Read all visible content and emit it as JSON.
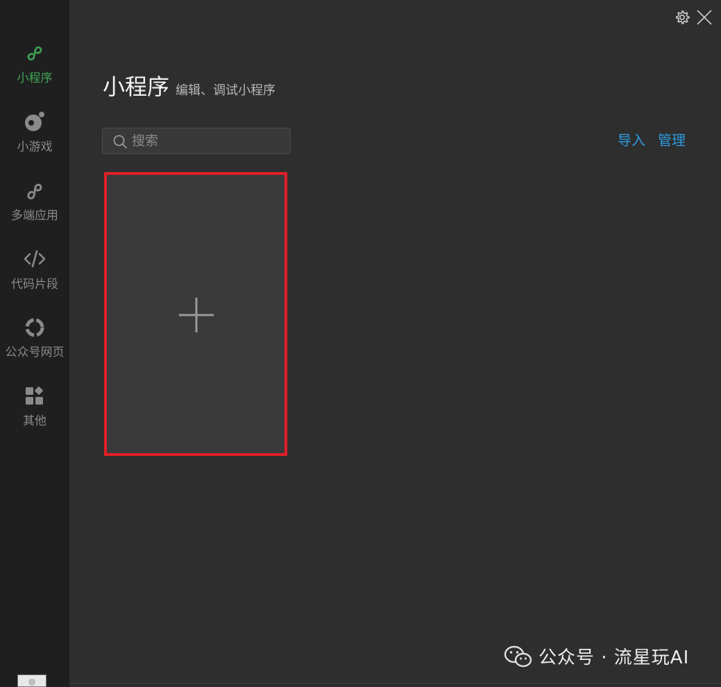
{
  "sidebar": {
    "items": [
      {
        "label": "小程序",
        "icon": "mini-program-icon",
        "active": true
      },
      {
        "label": "小游戏",
        "icon": "mini-game-icon",
        "active": false
      },
      {
        "label": "多端应用",
        "icon": "multi-platform-icon",
        "active": false
      },
      {
        "label": "代码片段",
        "icon": "code-icon",
        "active": false
      },
      {
        "label": "公众号网页",
        "icon": "official-account-icon",
        "active": false
      },
      {
        "label": "其他",
        "icon": "grid-icon",
        "active": false
      }
    ]
  },
  "header": {
    "title": "小程序",
    "subtitle": "编辑、调试小程序"
  },
  "search": {
    "placeholder": "搜索",
    "value": ""
  },
  "actions": {
    "import_label": "导入",
    "manage_label": "管理"
  },
  "watermark": {
    "text": "公众号 · 流星玩AI"
  },
  "colors": {
    "accent_green": "#3ea556",
    "link_blue": "#2d9be0",
    "highlight_red": "#e02027",
    "background": "#2e2e2e",
    "sidebar_bg": "#1f1f1f"
  }
}
